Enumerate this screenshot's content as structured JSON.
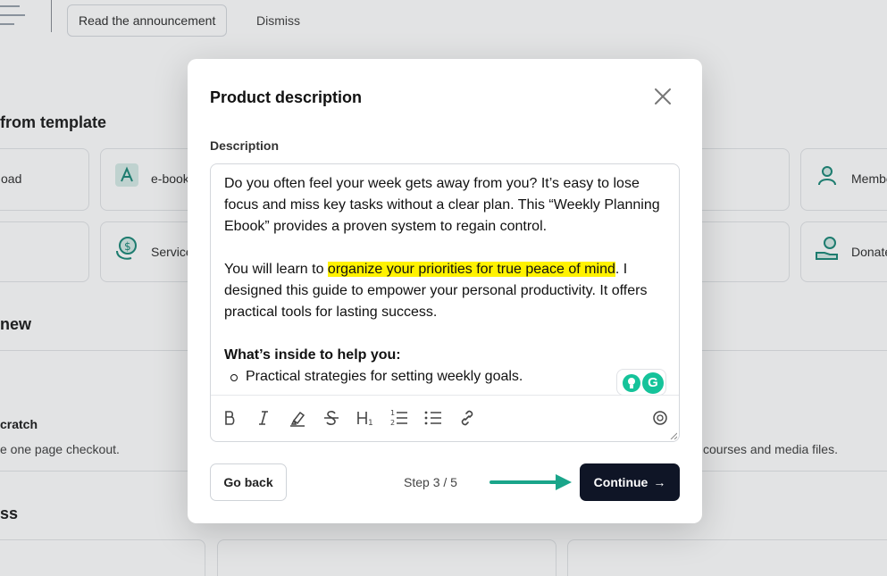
{
  "topbar": {
    "announcement_button": "Read the announcement",
    "dismiss": "Dismiss"
  },
  "background": {
    "template_title": "from template",
    "cards": [
      {
        "label": "oad"
      },
      {
        "label": "e-book"
      },
      {
        "label": "Members"
      },
      {
        "label": "Service"
      },
      {
        "label": "Donate"
      }
    ],
    "new_title": "new",
    "scratch_title": "cratch",
    "scratch_desc": "e one page checkout.",
    "courses_desc": "courses and media files.",
    "ss_title": "ss"
  },
  "modal": {
    "title": "Product description",
    "description_label": "Description",
    "content": {
      "p1": "Do you often feel your week gets away from you? It’s easy to lose focus and miss key tasks without a clear plan. This “Weekly Planning Ebook” provides a proven system to regain control.",
      "p2_before": "You will learn to ",
      "p2_highlight": "organize your priorities for true peace of mind",
      "p2_after": ". I designed this guide to empower your personal productivity. It offers practical tools for lasting success.",
      "heading": "What’s inside to help you:",
      "list": [
        "Practical strategies for setting weekly goals."
      ]
    },
    "toolbar_icons": [
      "bold-icon",
      "italic-icon",
      "highlight-icon",
      "strikethrough-icon",
      "heading-icon",
      "ordered-list-icon",
      "bullet-list-icon",
      "link-icon",
      "emoji-icon"
    ],
    "go_back": "Go back",
    "step": "Step 3 / 5",
    "continue": "Continue",
    "continue_arrow": "→"
  },
  "colors": {
    "primary_button": "#0f1526",
    "highlight": "#fff200",
    "accent_arrow": "#1aa58a",
    "icon_teal": "#1f8a7a"
  }
}
